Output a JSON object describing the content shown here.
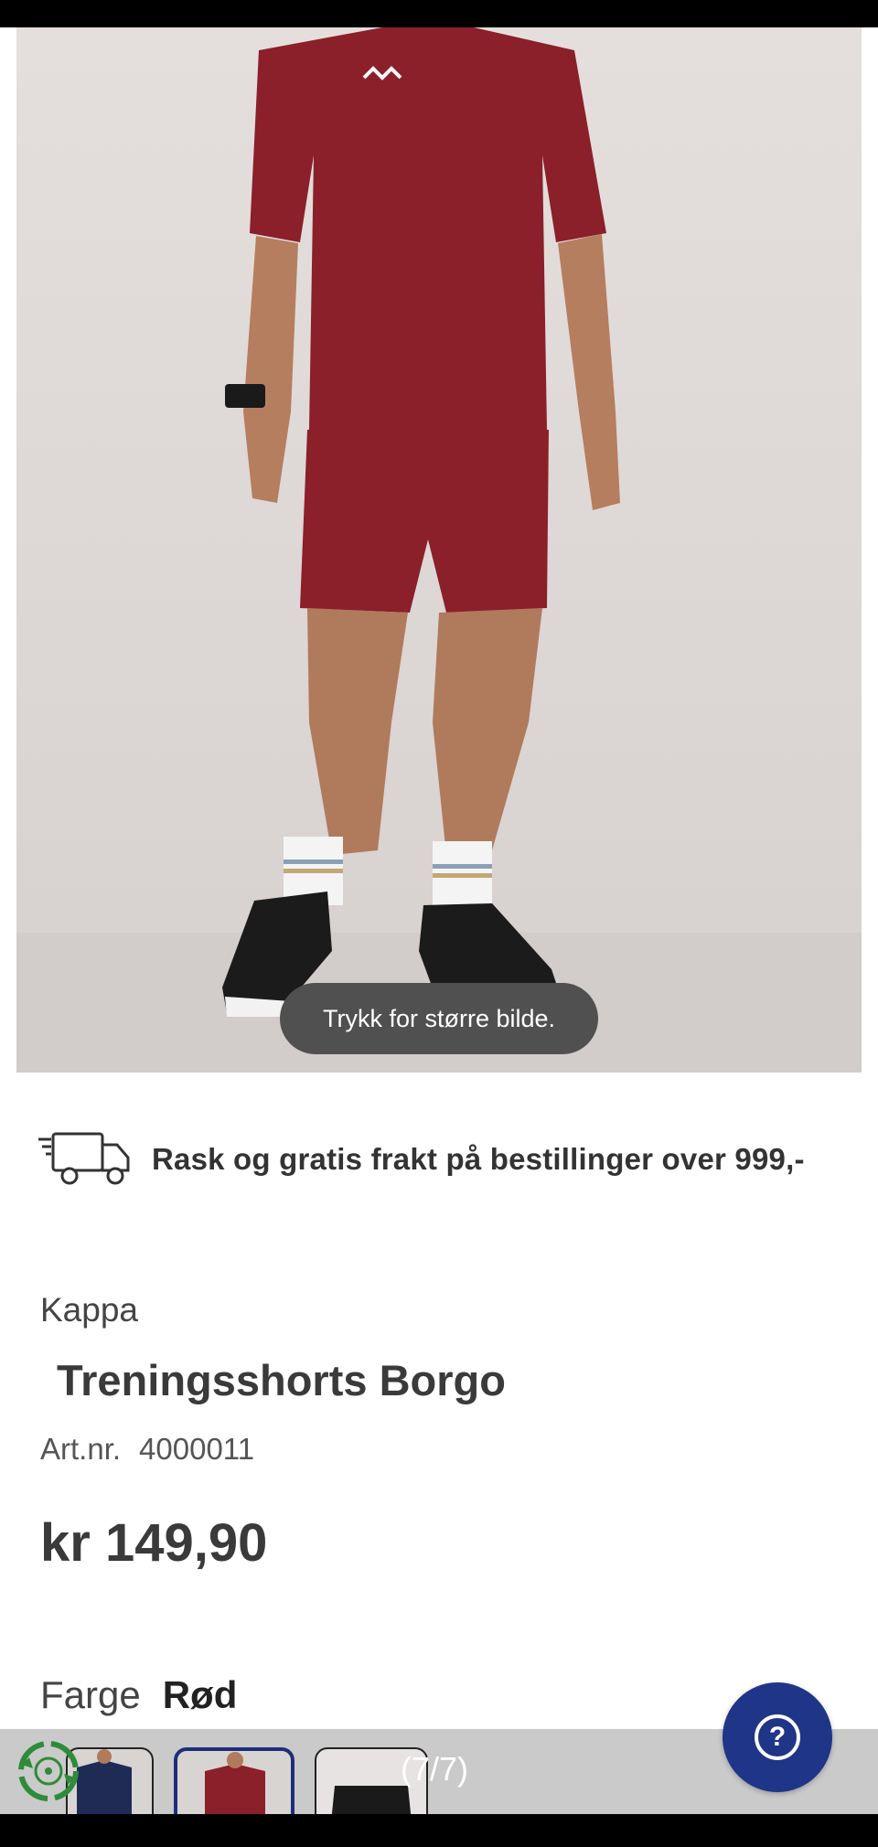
{
  "image": {
    "tap_hint": "Trykk for større bilde."
  },
  "shipping": {
    "icon": "delivery-truck-icon",
    "text": "Rask og gratis frakt på bestillinger over 999,-"
  },
  "product": {
    "brand": "Kappa",
    "title": "Treningsshorts Borgo",
    "artnr_label": "Art.nr.",
    "artnr_value": "4000011",
    "price": "kr 149,90",
    "color_label": "Farge",
    "color_value": "Rød"
  },
  "gallery": {
    "counter": "(7/7)"
  },
  "colors": {
    "garment": "#8b1f2a",
    "help_button": "#1f3587",
    "eco_badge": "#2e8b3a"
  },
  "icons": {
    "help": "question-mark-icon",
    "eco": "recycle-badge-icon"
  }
}
